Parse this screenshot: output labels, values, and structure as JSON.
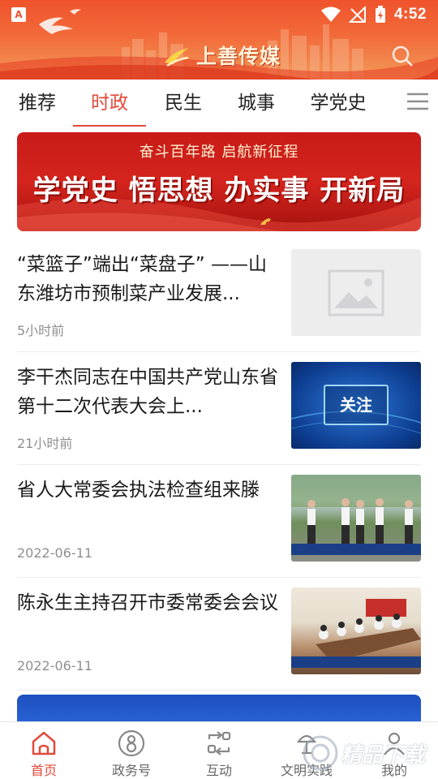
{
  "status_bar": {
    "notification_icon": "a-badge-icon",
    "notification_letter": "A",
    "time": "4:52"
  },
  "header": {
    "app_name": "上善传媒",
    "search_icon": "search-icon",
    "colors": {
      "primary": "#f0532c",
      "accent": "#e24a3b"
    }
  },
  "tabs": {
    "items": [
      "推荐",
      "时政",
      "民生",
      "城事",
      "学党史",
      "-"
    ],
    "active_index": 1,
    "menu_icon": "hamburger-menu-icon"
  },
  "banner": {
    "subtitle": "奋斗百年路 启航新征程",
    "title": "学党史 悟思想 办实事 开新局"
  },
  "news": [
    {
      "title": "“菜篮子”端出“菜盘子” ——山东潍坊市预制菜产业发展...",
      "time": "5小时前",
      "thumb": "image-placeholder-icon"
    },
    {
      "title": "李干杰同志在中国共产党山东省第十二次代表大会上...",
      "time": "21小时前",
      "thumb": "关注"
    },
    {
      "title": "省人大常委会执法检查组来滕",
      "time": "2022-06-11",
      "thumb": "photo"
    },
    {
      "title": "陈永生主持召开市委常委会会议",
      "time": "2022-06-11",
      "thumb": "photo"
    }
  ],
  "bottom_nav": {
    "items": [
      {
        "label": "首页",
        "icon": "home-icon",
        "active": true
      },
      {
        "label": "政务号",
        "icon": "government-account-icon",
        "active": false
      },
      {
        "label": "互动",
        "icon": "interaction-icon",
        "active": false
      },
      {
        "label": "文明实践",
        "icon": "civilization-practice-icon",
        "active": false
      },
      {
        "label": "我的",
        "icon": "profile-icon",
        "active": false
      }
    ]
  },
  "watermark": {
    "text": "精品下载"
  }
}
